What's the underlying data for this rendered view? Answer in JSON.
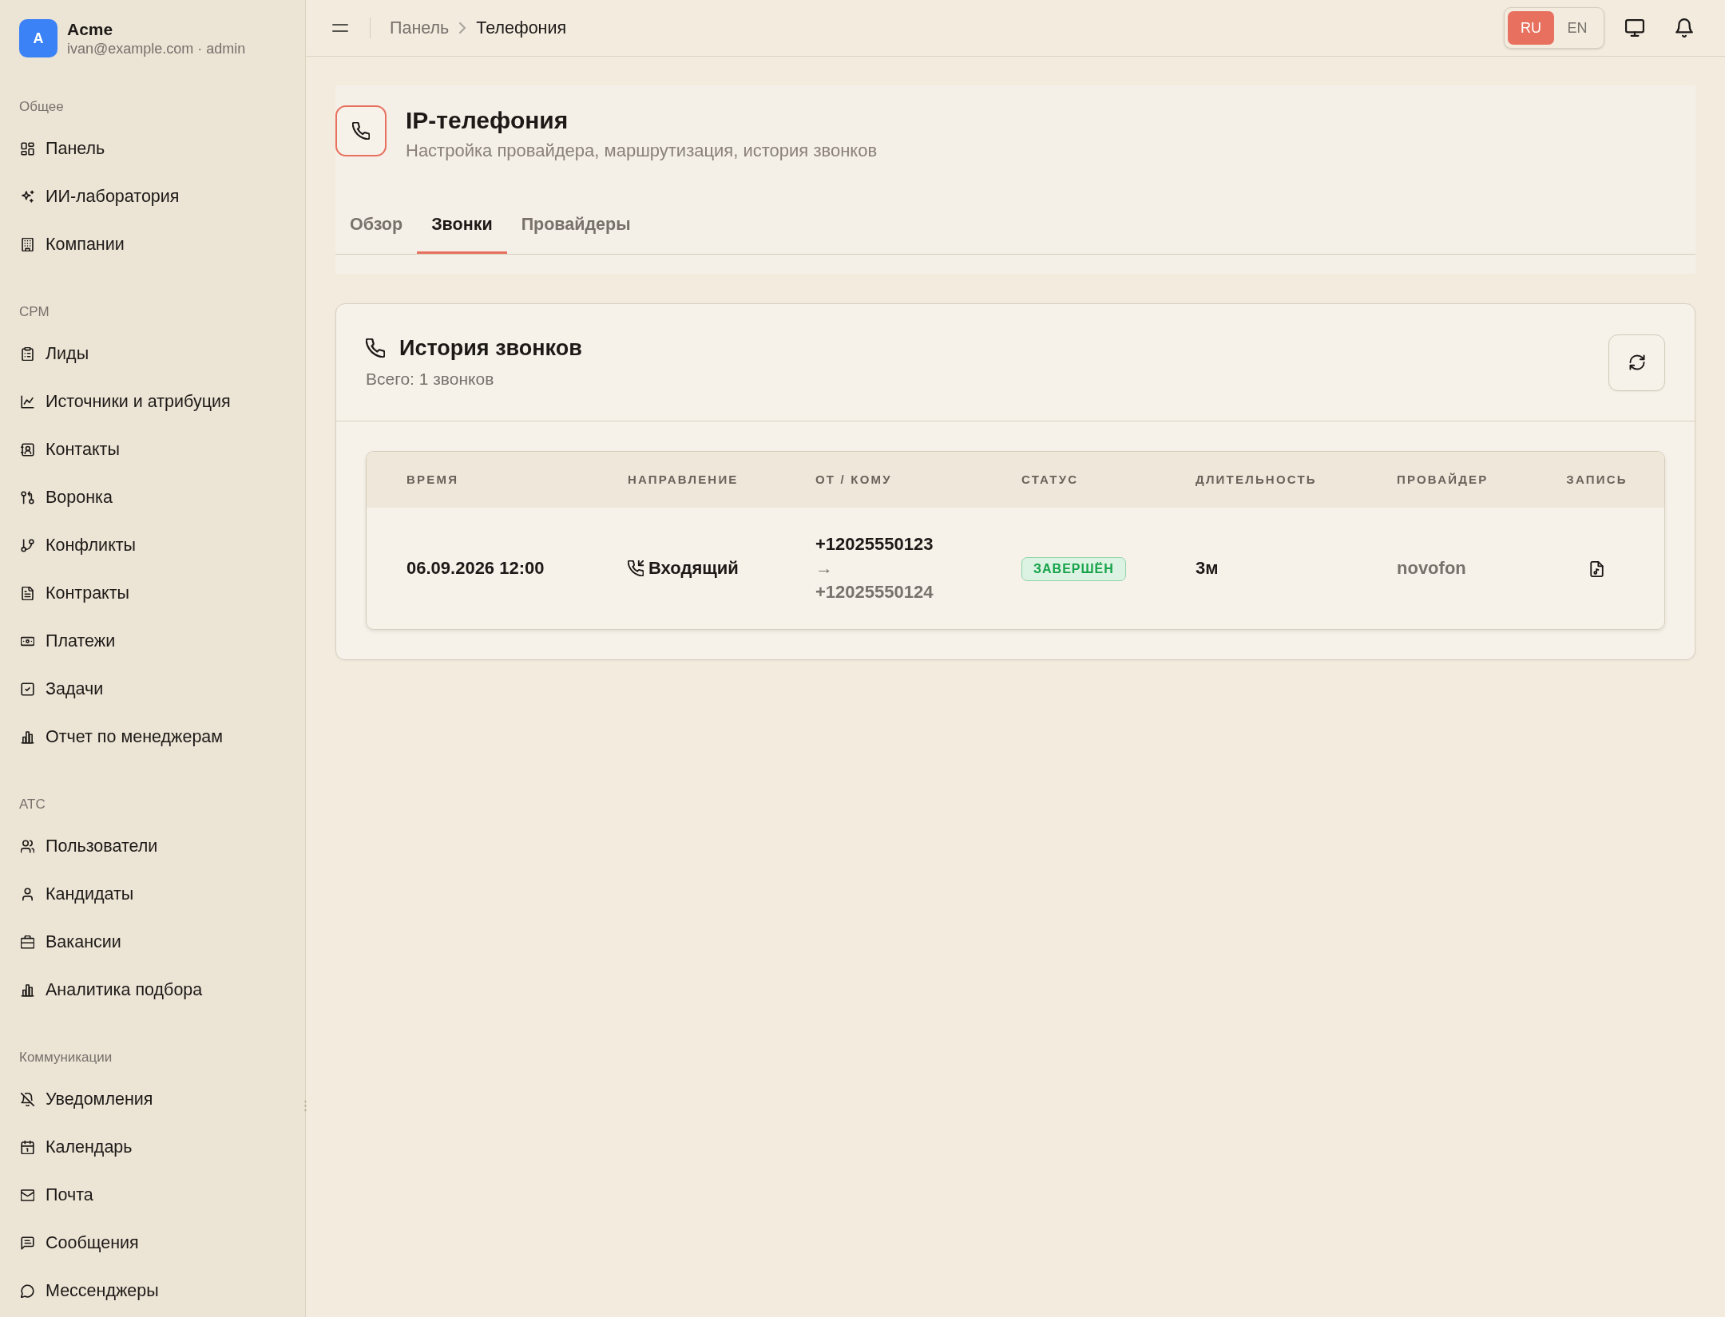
{
  "sidebar": {
    "brand": {
      "avatar": "A",
      "name": "Acme",
      "account": "ivan@example.com · admin"
    },
    "sections": [
      {
        "title": "Общее",
        "items": [
          {
            "label": "Панель",
            "selected": false
          },
          {
            "label": "ИИ-лаборатория",
            "selected": false
          },
          {
            "label": "Компании",
            "selected": false
          }
        ]
      },
      {
        "title": "CPM",
        "items": [
          {
            "label": "Лиды",
            "selected": false
          },
          {
            "label": "Источники и атрибуция",
            "selected": false
          },
          {
            "label": "Контакты",
            "selected": false
          },
          {
            "label": "Воронка",
            "selected": false
          },
          {
            "label": "Конфликты",
            "selected": false
          },
          {
            "label": "Контракты",
            "selected": false
          },
          {
            "label": "Платежи",
            "selected": false
          },
          {
            "label": "Задачи",
            "selected": false
          },
          {
            "label": "Отчет по менеджерам",
            "selected": false
          }
        ]
      },
      {
        "title": "ATC",
        "items": [
          {
            "label": "Пользователи",
            "selected": false
          },
          {
            "label": "Кандидаты",
            "selected": false
          },
          {
            "label": "Вакансии",
            "selected": false
          },
          {
            "label": "Аналитика подбора",
            "selected": false
          }
        ]
      },
      {
        "title": "Коммуникации",
        "items": [
          {
            "label": "Уведомления",
            "selected": false
          },
          {
            "label": "Календарь",
            "selected": false
          },
          {
            "label": "Почта",
            "selected": false
          },
          {
            "label": "Сообщения",
            "selected": false
          },
          {
            "label": "Мессенджеры",
            "selected": false
          }
        ]
      }
    ]
  },
  "topbar": {
    "breadcrumb": [
      "Панель",
      "Телефония"
    ],
    "languages": [
      {
        "label": "RU",
        "selected": true
      },
      {
        "label": "EN",
        "selected": false
      }
    ]
  },
  "page_header": {
    "title": "IP-телефония",
    "subtitle": "Настройка провайдера, маршрутизация, история звонков",
    "tabs": [
      {
        "label": "Обзор",
        "selected": false
      },
      {
        "label": "Звонки",
        "selected": true
      },
      {
        "label": "Провайдеры",
        "selected": false
      }
    ]
  },
  "call_history": {
    "title": "История звонков",
    "summary": "Всего: 1 звонков",
    "table": {
      "columns": [
        "ВРЕМЯ",
        "НАПРАВЛЕНИЕ",
        "ОТ / КОМУ",
        "СТАТУС",
        "ДЛИТЕЛЬНОСТЬ",
        "ПРОВАЙДЕР",
        "ЗАПИСЬ"
      ],
      "rows": [
        {
          "time": "06.09.2026 12:00",
          "direction": "Входящий",
          "from": "+12025550123",
          "arrow": "→",
          "to": "+12025550124",
          "status": {
            "label": "ЗАВЕРШЁН",
            "kind": "success"
          },
          "duration": "3м",
          "provider": "novofon",
          "recording": true
        }
      ]
    }
  }
}
